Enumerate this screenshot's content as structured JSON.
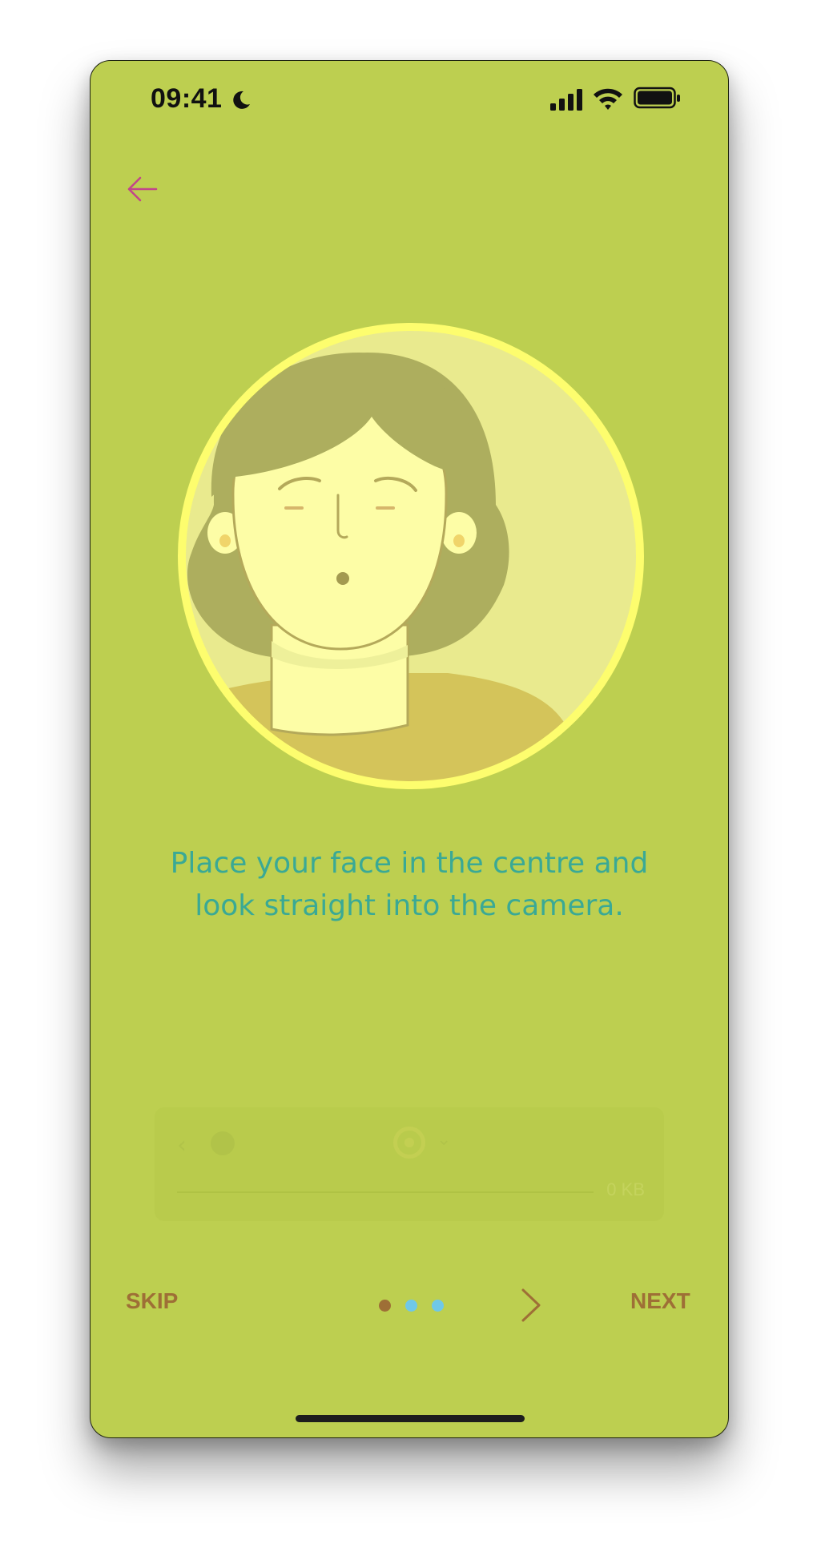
{
  "status_bar": {
    "time": "09:41",
    "icons": [
      "moon-icon",
      "cellular-signal-icon",
      "wifi-icon",
      "battery-icon"
    ]
  },
  "header": {
    "back_icon": "arrow-left-icon"
  },
  "illustration": {
    "subject": "face-guide-avatar"
  },
  "instruction": {
    "text": "Place your face in the centre and look straight into the camera."
  },
  "faded_panel": {
    "size_label": "0 KB"
  },
  "footer": {
    "skip_label": "SKIP",
    "next_label": "NEXT",
    "pager": {
      "total": 3,
      "active_index": 0
    },
    "next_icon": "chevron-right-icon"
  },
  "colors": {
    "background": "#bdcf50",
    "accent_text": "#3aa995",
    "button_text": "#9e6f36",
    "back_arrow": "#c2458a",
    "pager_active": "#9e6f36",
    "pager_inactive": "#6fc8e8",
    "ring": "#fdfd6e"
  }
}
